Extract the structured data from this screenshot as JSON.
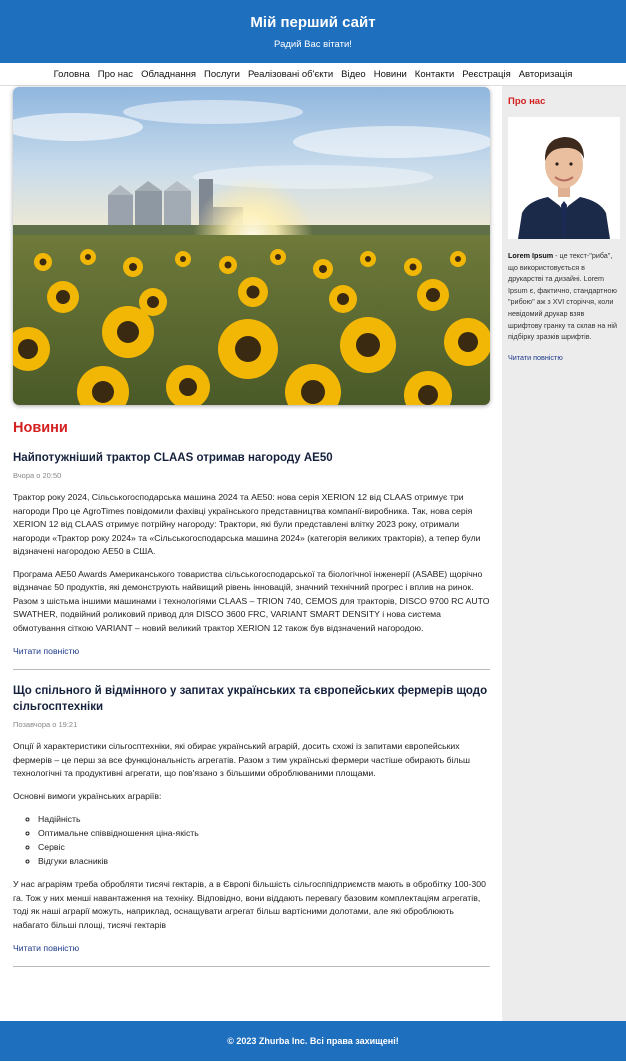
{
  "header": {
    "title": "Мій перший сайт",
    "tagline": "Радий Вас вітати!"
  },
  "nav": {
    "items": [
      "Головна",
      "Про нас",
      "Обладнання",
      "Послуги",
      "Реалізовані об'єкти",
      "Відео",
      "Новини",
      "Контакти",
      "Реєстрація",
      "Авторизація"
    ]
  },
  "main": {
    "hero_image": "sunflower-field-with-grain-silos",
    "section_title": "Новини",
    "articles": [
      {
        "title": "Найпотужніший трактор CLAAS отримав нагороду AE50",
        "date": "Вчора о 20:50",
        "paragraphs": [
          "Трактор року 2024, Сільськогосподарська машина 2024 та AE50: нова серія XERION 12 від CLAAS отримує три нагороди Про це AgroTimes повідомили фахівці українського представництва компанії-виробника. Так, нова серія XERION 12 від CLAAS отримує потрійну нагороду: Трактори, які були представлені влітку 2023 року, отримали нагороди «Трактор року 2024» та «Сільськогосподарська машина 2024» (категорія великих тракторів), а тепер були відзначені нагородою AE50 в США.",
          "Програма AE50 Awards Американського товариства сільськогосподарської та біологічної інженерії (ASABE) щорічно відзначає 50 продуктів, які демонструють найвищий рівень інновацій, значний технічний прогрес і вплив на ринок. Разом з шістьма іншими машинами і технологіями CLAAS – TRION 740, CEMOS для тракторів, DISCO 9700 RC AUTO SWATHER, подвійний роликовий привод для DISCO 3600 FRC, VARIANT SMART DENSITY і нова система обмотування сіткою VARIANT – новий великий трактор XERION 12 також був відзначений нагородою."
        ],
        "read_more": "Читати повністю"
      },
      {
        "title": "Що спільного й відмінного у запитах українських та європейських фермерів щодо сільгосптехніки",
        "date": "Позавчора о 19:21",
        "paragraphs": [
          "Опції й характеристики сільгосптехніки, які обирає український аграрій, досить схожі із запитами європейських фермерів – це перш за все функціональність агрегатів. Разом з тим українські фермери частіше обирають більш технологічні та продуктивні агрегати, що пов'язано з більшими оброблюваними площами.",
          "Основні вимоги українських аграріїв:"
        ],
        "list": [
          "Надійність",
          "Оптимальне співвідношення ціна-якість",
          "Сервіс",
          "Відгуки власників"
        ],
        "closing": "У нас аграріям треба обробляти тисячі гектарів, а в Європі більшість сільгосппідприємств мають в обробітку 100-300 га. Тож у них менші навантаження на техніку. Відповідно, вони віддають перевагу базовим комплектаціям агрегатів, тоді як наші аграрії можуть, наприклад, оснащувати агрегат більш вартісними долотами, але які оброблюють набагато більші площі, тисячі гектарів",
        "read_more": "Читати повністю"
      }
    ]
  },
  "sidebar": {
    "title": "Про нас",
    "avatar": "businessman-portrait",
    "text_bold": "Lorem Ipsum",
    "text": " - це текст-\"риба\", що використовується в друкарстві та дизайні. Lorem Ipsum є, фактично, стандартною \"рибою\" аж з XVI сторіччя, коли невідомий друкар взяв шрифтову гранку та склав на ній підбірку зразків шрифтів.",
    "read_more": "Читати повністю"
  },
  "footer": {
    "text": "© 2023 Zhurba Inc. Всі права захищені!"
  },
  "colors": {
    "header": "#1f6fbf",
    "accent_red": "#d32020",
    "link": "#1d3a8a",
    "sidebar_bg": "#ececec"
  }
}
